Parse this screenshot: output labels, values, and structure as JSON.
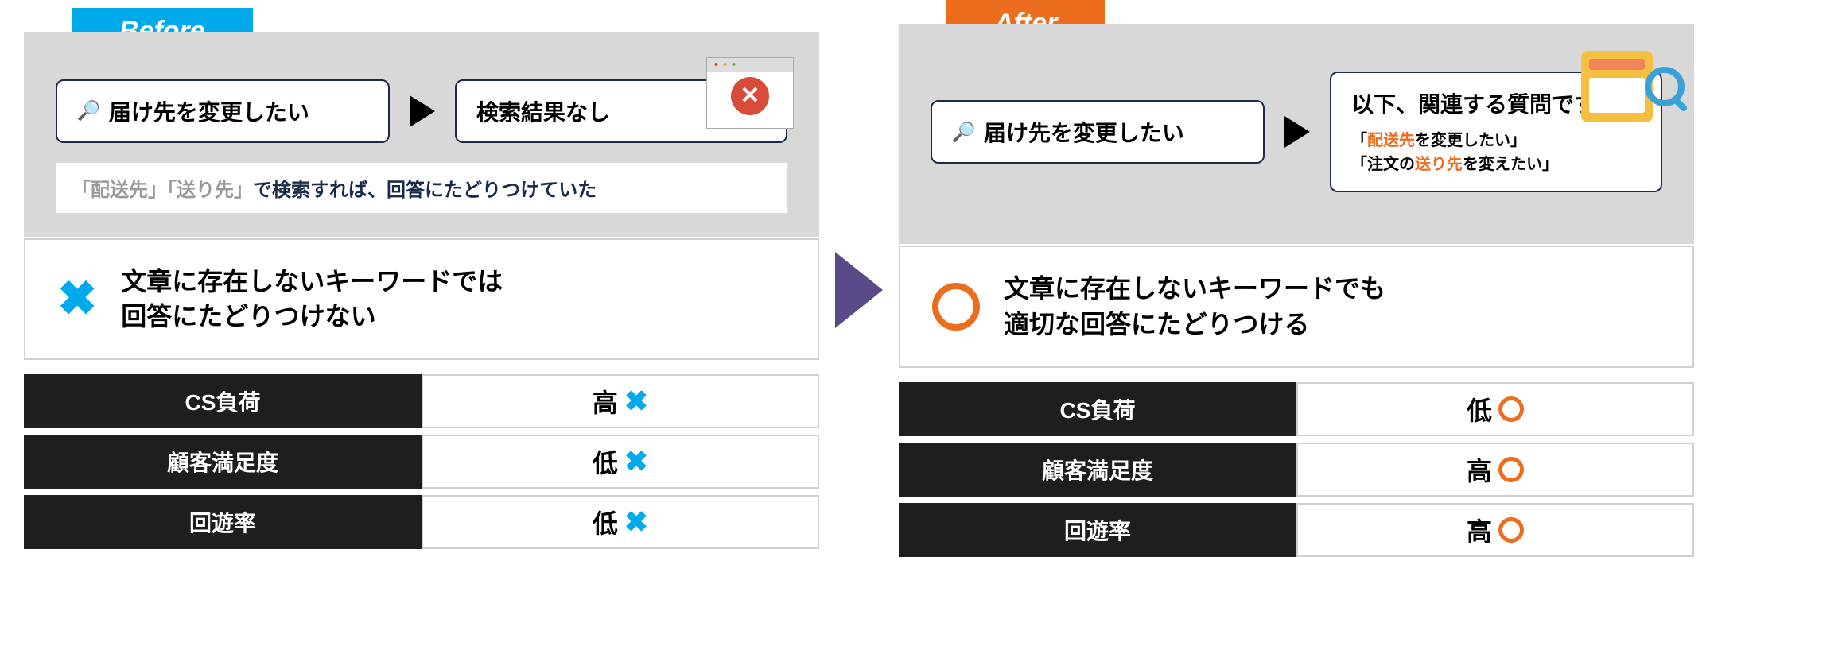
{
  "before": {
    "tab": "Before",
    "search_query": "届け先を変更したい",
    "result": "検索結果なし",
    "hint_gray": "「配送先」「送り先」",
    "hint_rest": "で検索すれば、回答にたどりつけていた",
    "summary_line1": "文章に存在しないキーワードでは",
    "summary_line2": "回答にたどりつけない",
    "rows": [
      {
        "label": "CS負荷",
        "value": "高"
      },
      {
        "label": "顧客満足度",
        "value": "低"
      },
      {
        "label": "回遊率",
        "value": "低"
      }
    ]
  },
  "after": {
    "tab": "After",
    "search_query": "届け先を変更したい",
    "result_header": "以下、関連する質問です。",
    "sugg1_pre": "「",
    "sugg1_hl": "配送先",
    "sugg1_post": "を変更したい」",
    "sugg2_pre": "「注文の",
    "sugg2_hl": "送り先",
    "sugg2_post": "を変えたい」",
    "summary_line1": "文章に存在しないキーワードでも",
    "summary_line2": "適切な回答にたどりつける",
    "rows": [
      {
        "label": "CS負荷",
        "value": "低"
      },
      {
        "label": "顧客満足度",
        "value": "高"
      },
      {
        "label": "回遊率",
        "value": "高"
      }
    ]
  }
}
